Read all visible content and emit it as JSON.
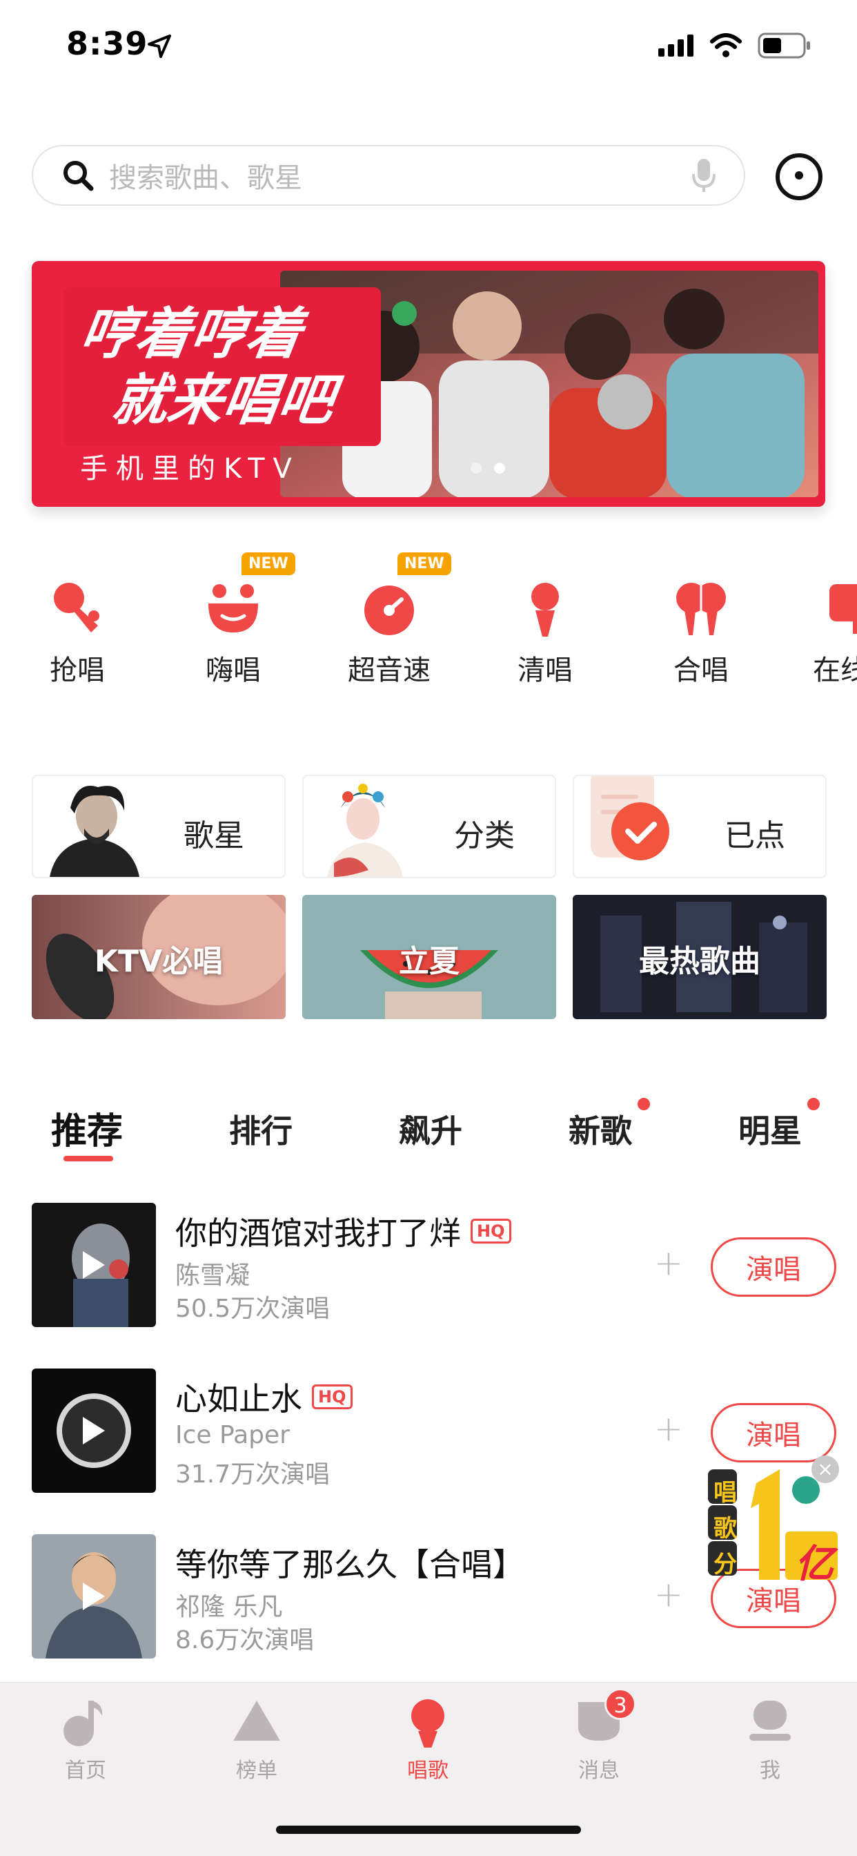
{
  "status_bar": {
    "time": "8:39"
  },
  "search": {
    "placeholder": "搜索歌曲、歌星"
  },
  "banner": {
    "headline_line1": "哼着哼着",
    "headline_line2": "就来唱吧",
    "subtitle": "手机里的KTV"
  },
  "quick_actions": [
    {
      "label": "抢唱",
      "icon": "microphone-grab-icon",
      "is_new": false
    },
    {
      "label": "嗨唱",
      "icon": "smile-face-icon",
      "is_new": true
    },
    {
      "label": "超音速",
      "icon": "speed-dial-icon",
      "is_new": true
    },
    {
      "label": "清唱",
      "icon": "microphone-icon",
      "is_new": false
    },
    {
      "label": "合唱",
      "icon": "duet-icon",
      "is_new": false
    },
    {
      "label": "在线",
      "icon": "online-icon",
      "is_new": false
    }
  ],
  "new_badge": "NEW",
  "entries": [
    {
      "label": "歌星"
    },
    {
      "label": "分类"
    },
    {
      "label": "已点"
    }
  ],
  "playlists": [
    {
      "label": "KTV必唱"
    },
    {
      "label": "立夏"
    },
    {
      "label": "最热歌曲"
    }
  ],
  "tabs": [
    {
      "label": "推荐",
      "active": true,
      "dot": false
    },
    {
      "label": "排行",
      "active": false,
      "dot": false
    },
    {
      "label": "飙升",
      "active": false,
      "dot": false
    },
    {
      "label": "新歌",
      "active": false,
      "dot": true
    },
    {
      "label": "明星",
      "active": false,
      "dot": true
    }
  ],
  "songs": [
    {
      "title": "你的酒馆对我打了烊",
      "hq": "HQ",
      "artist": "陈雪凝",
      "count": "50.5万次演唱",
      "action": "演唱"
    },
    {
      "title": "心如止水",
      "hq": "HQ",
      "artist": "Ice Paper",
      "count": "31.7万次演唱",
      "action": "演唱"
    },
    {
      "title": "等你等了那么久【合唱】",
      "hq": "",
      "artist": "祁隆 乐凡",
      "count": "8.6万次演唱",
      "action": "演唱"
    }
  ],
  "promo": {
    "line1": "唱",
    "line2": "歌",
    "line3": "分",
    "big": "1",
    "unit": "亿"
  },
  "bottom_nav": [
    {
      "label": "首页",
      "icon": "music-note-icon",
      "active": false
    },
    {
      "label": "榜单",
      "icon": "triangle-chart-icon",
      "active": false
    },
    {
      "label": "唱歌",
      "icon": "microphone-icon",
      "active": true
    },
    {
      "label": "消息",
      "icon": "message-icon",
      "active": false,
      "badge": "3"
    },
    {
      "label": "我",
      "icon": "profile-icon",
      "active": false
    }
  ],
  "colors": {
    "accent": "#f04747",
    "banner": "#e8223f",
    "badge": "#f6a300"
  }
}
